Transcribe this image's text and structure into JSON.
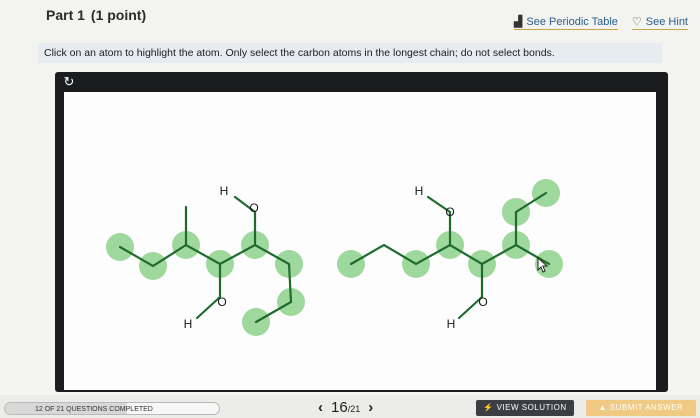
{
  "header": {
    "part_title": "Part 1",
    "points": "(1 point)",
    "periodic_link": "See Periodic Table",
    "hint_link": "See Hint"
  },
  "instruction": "Click on an atom to highlight the atom. Only select the carbon atoms in the longest chain; do not select bonds.",
  "molecule_labels": {
    "h": "H",
    "o": "O"
  },
  "footer": {
    "progress_text": "12 OF 21 QUESTIONS COMPLETED",
    "progress_fraction": 0.571,
    "page_current": "16",
    "page_total": "/21",
    "prev": "‹",
    "next": "›",
    "view_solution": "VIEW SOLUTION",
    "submit": "SUBMIT ANSWER"
  },
  "colors": {
    "highlight": "#9fd89d",
    "frame": "#1b1c1e",
    "link": "#2a5d8f",
    "submit": "#f0c983"
  }
}
